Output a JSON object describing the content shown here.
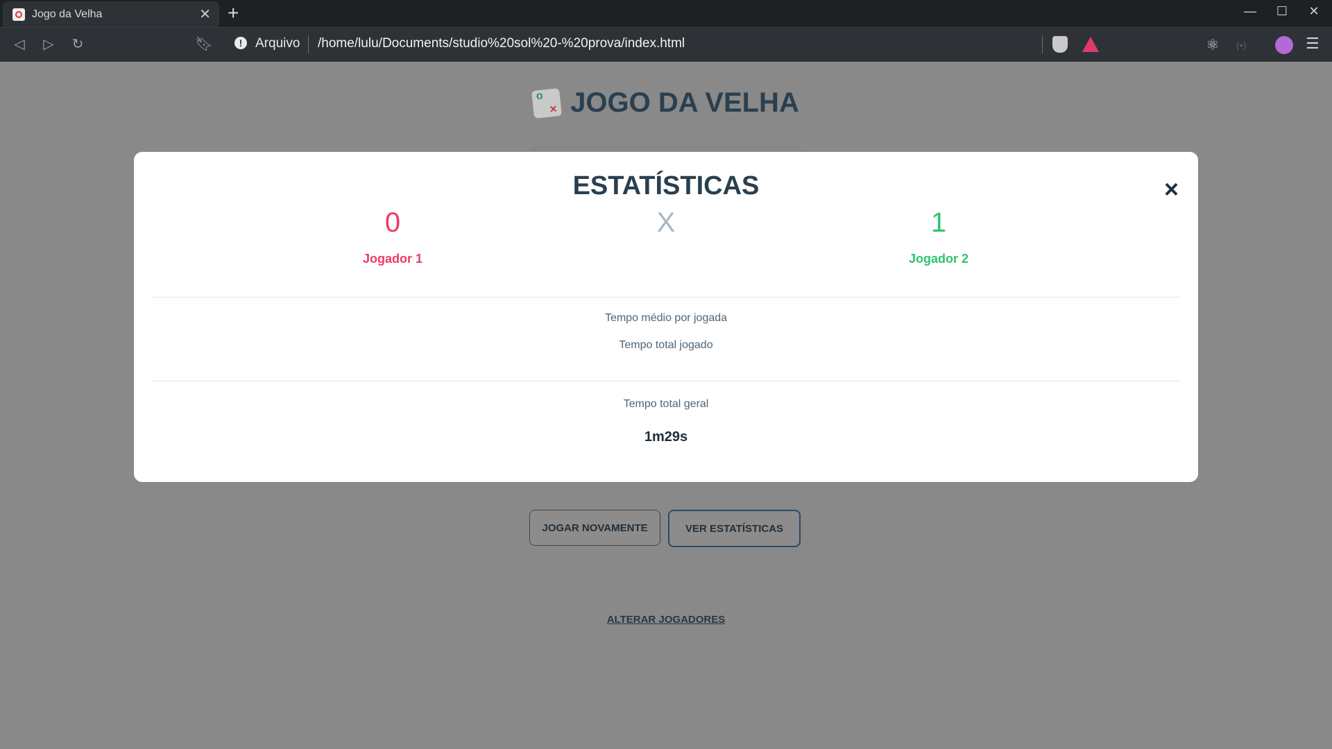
{
  "browser": {
    "tab_title": "Jogo da Velha",
    "url_label": "Arquivo",
    "url": "/home/lulu/Documents/studio%20sol%20-%20prova/index.html"
  },
  "page": {
    "title": "JOGO DA VELHA",
    "buttons": {
      "play_again": "JOGAR NOVAMENTE",
      "view_stats": "VER ESTATÍSTICAS"
    },
    "change_players": "ALTERAR JOGADORES"
  },
  "modal": {
    "title": "ESTATÍSTICAS",
    "close": "×",
    "player1": {
      "score": "0",
      "name": "Jogador 1",
      "color": "#ec3b63"
    },
    "versus": "X",
    "player2": {
      "score": "1",
      "name": "Jogador 2",
      "color": "#2cc46c"
    },
    "avg_time_label": "Tempo médio por jogada",
    "total_time_label": "Tempo total jogado",
    "overall_time_label": "Tempo total geral",
    "overall_time_value": "1m29s"
  }
}
